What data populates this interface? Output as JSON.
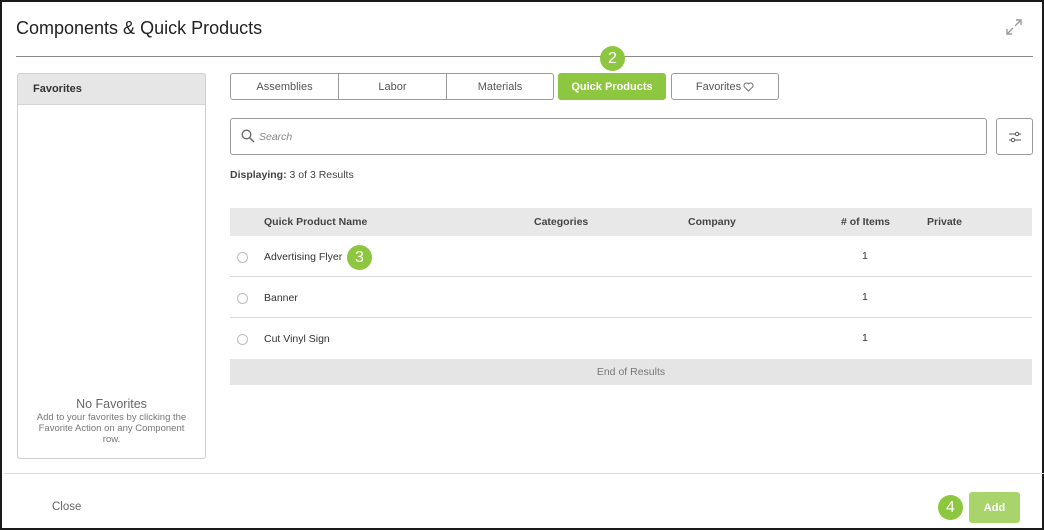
{
  "dialog": {
    "title": "Components & Quick Products"
  },
  "favorites_panel": {
    "header": "Favorites",
    "empty_title": "No Favorites",
    "empty_description": "Add to your favorites by clicking the Favorite Action on any Component row."
  },
  "tabs": {
    "assemblies": "Assemblies",
    "labor": "Labor",
    "materials": "Materials",
    "quick_products": "Quick Products",
    "favorites": "Favorites",
    "active": "Quick Products"
  },
  "badges": {
    "tab": "2",
    "row": "3",
    "add": "4"
  },
  "search": {
    "placeholder": "Search",
    "value": ""
  },
  "results": {
    "label": "Displaying:",
    "text": "3 of 3 Results"
  },
  "table": {
    "columns": {
      "name": "Quick Product Name",
      "categories": "Categories",
      "company": "Company",
      "items": "# of Items",
      "private": "Private"
    },
    "rows": [
      {
        "name": "Advertising Flyer",
        "categories": "",
        "company": "",
        "items": "1",
        "private": ""
      },
      {
        "name": "Banner",
        "categories": "",
        "company": "",
        "items": "1",
        "private": ""
      },
      {
        "name": "Cut Vinyl Sign",
        "categories": "",
        "company": "",
        "items": "1",
        "private": ""
      }
    ],
    "end_text": "End of Results"
  },
  "footer": {
    "close_label": "Close",
    "add_label": "Add"
  },
  "colors": {
    "accent": "#8dc63f",
    "accent_light": "#a9d46b",
    "header_bg": "#e8e8e8"
  },
  "icons": [
    "expand-icon",
    "heart-icon",
    "search-icon",
    "filter-icon"
  ]
}
